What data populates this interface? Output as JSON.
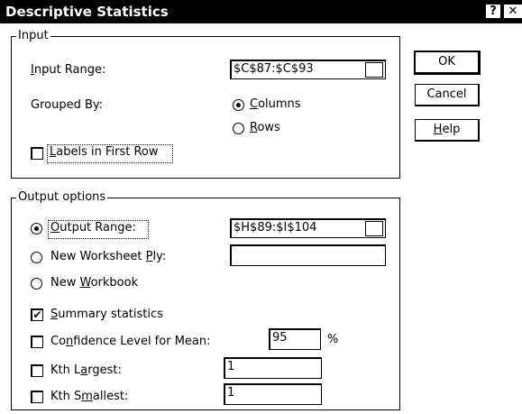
{
  "dialog": {
    "title": "Descriptive Statistics",
    "help_glyph": "?",
    "close_glyph": "✕"
  },
  "input_group": {
    "legend": "Input",
    "input_range_label_pre": "",
    "input_range_label_u": "I",
    "input_range_label_post": "nput Range:",
    "input_range_value": "$C$87:$C$93",
    "grouped_by_label": "Grouped By:",
    "columns_u": "C",
    "columns_post": "olumns",
    "rows_u": "R",
    "rows_post": "ows",
    "columns_selected": true,
    "labels_u": "L",
    "labels_post": "abels in First Row",
    "labels_checked": false
  },
  "buttons": {
    "ok": "OK",
    "cancel": "Cancel",
    "help_u": "H",
    "help_post": "elp"
  },
  "output_group": {
    "legend": "Output options",
    "output_range_u": "O",
    "output_range_post": "utput Range:",
    "output_range_value": "$H$89:$I$104",
    "new_sheet_pre": "New Worksheet ",
    "new_sheet_u": "P",
    "new_sheet_post": "ly:",
    "new_sheet_value": "",
    "new_workbook_pre": "New ",
    "new_workbook_u": "W",
    "new_workbook_post": "orkbook",
    "selected_output": "output_range",
    "summary_u": "S",
    "summary_post": "ummary statistics",
    "summary_checked": true,
    "confidence_pre": "Co",
    "confidence_u": "n",
    "confidence_post": "fidence Level for Mean:",
    "confidence_checked": false,
    "confidence_value": "95",
    "confidence_unit": "%",
    "kth_largest_pre": "Kth L",
    "kth_largest_u": "a",
    "kth_largest_post": "rgest:",
    "kth_largest_checked": false,
    "kth_largest_value": "1",
    "kth_smallest_pre": "Kth S",
    "kth_smallest_u": "m",
    "kth_smallest_post": "allest:",
    "kth_smallest_checked": false,
    "kth_smallest_value": "1"
  }
}
